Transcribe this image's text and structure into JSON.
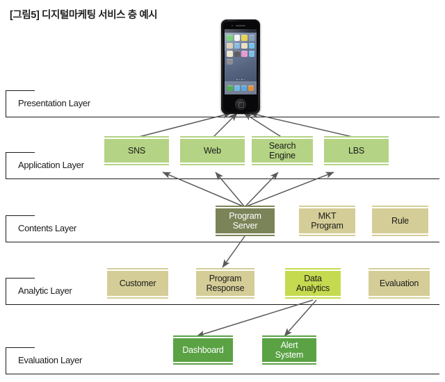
{
  "title": "[그림5] 디지털마케팅 서비스 층 예시",
  "layers": [
    {
      "id": "presentation",
      "label": "Presentation Layer"
    },
    {
      "id": "application",
      "label": "Application Layer"
    },
    {
      "id": "contents",
      "label": "Contents Layer"
    },
    {
      "id": "analytic",
      "label": "Analytic Layer"
    },
    {
      "id": "evaluation",
      "label": "Evaluation Layer"
    }
  ],
  "nodes": {
    "sns": {
      "label": "SNS",
      "tone": "#b4d384"
    },
    "web": {
      "label": "Web",
      "tone": "#b4d384"
    },
    "search_engine": {
      "label": "Search\nEngine",
      "tone": "#b4d384"
    },
    "lbs": {
      "label": "LBS",
      "tone": "#b4d384"
    },
    "program_server": {
      "label": "Program\nServer",
      "tone": "#7b8358"
    },
    "mkt_program": {
      "label": "MKT\nProgram",
      "tone": "#d5cd97"
    },
    "rule": {
      "label": "Rule",
      "tone": "#d5cd97"
    },
    "customer": {
      "label": "Customer",
      "tone": "#d5cd97"
    },
    "program_response": {
      "label": "Program\nResponse",
      "tone": "#d5cd97"
    },
    "data_analytics": {
      "label": "Data\nAnalytics",
      "tone": "#c5da4f"
    },
    "evaluation_box": {
      "label": "Evaluation",
      "tone": "#d5cd97"
    },
    "dashboard": {
      "label": "Dashboard",
      "tone": "#5aa244"
    },
    "alert_system": {
      "label": "Alert\nSystem",
      "tone": "#5aa244"
    }
  },
  "device": {
    "name": "smartphone-icon",
    "app_colors": [
      "#5ec85e",
      "#f2f2f2",
      "#e8d24a",
      "#8ea0b8",
      "#d8c9a8",
      "#7fb6e0",
      "#e9e0c0",
      "#6fc4ea",
      "#efe7cc",
      "#5c5c62",
      "#e79bd0",
      "#7bbfe6",
      "#8d8d93",
      "",
      "",
      ""
    ],
    "dock_colors": [
      "#4fb04f",
      "#6fb9e6",
      "#59a8d8",
      "#e0913c"
    ]
  },
  "arrow_color": "#5a5a5a",
  "connections": [
    {
      "from": "sns",
      "to": "device"
    },
    {
      "from": "web",
      "to": "device"
    },
    {
      "from": "search_engine",
      "to": "device"
    },
    {
      "from": "lbs",
      "to": "device"
    },
    {
      "from": "program_server",
      "to": "sns"
    },
    {
      "from": "program_server",
      "to": "web"
    },
    {
      "from": "program_server",
      "to": "search_engine"
    },
    {
      "from": "program_server",
      "to": "lbs"
    },
    {
      "from": "program_server",
      "to": "program_response"
    },
    {
      "from": "data_analytics",
      "to": "dashboard"
    },
    {
      "from": "data_analytics",
      "to": "alert_system"
    }
  ]
}
